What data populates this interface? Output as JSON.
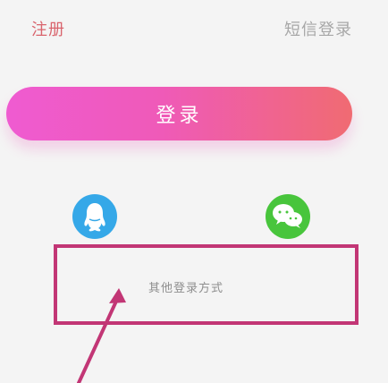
{
  "header": {
    "register_label": "注册",
    "sms_login_label": "短信登录"
  },
  "main": {
    "login_button_label": "登录",
    "social_login": {
      "qq_icon": "qq-icon",
      "wechat_icon": "wechat-icon"
    },
    "other_login_methods_label": "其他登录方式"
  },
  "colors": {
    "register_text": "#d9646d",
    "sms_login_text": "#a7a7a7",
    "login_gradient_start": "#ef5bd1",
    "login_gradient_end": "#f06b72",
    "qq_blue": "#35a8e8",
    "wechat_green": "#48c53c",
    "highlight": "#c23675"
  }
}
